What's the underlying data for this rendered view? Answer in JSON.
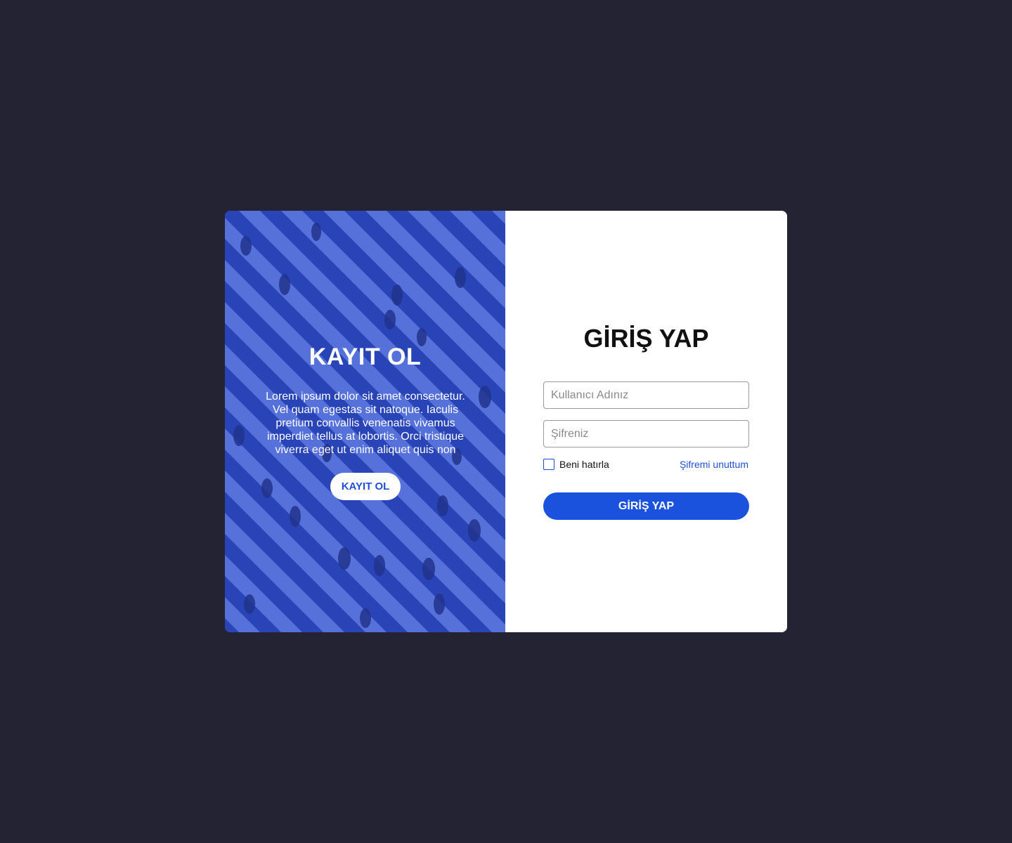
{
  "signup_panel": {
    "title": "KAYIT OL",
    "description": "Lorem ipsum dolor sit amet consectetur. Vel quam egestas sit natoque. Iaculis pretium convallis venenatis vivamus imperdiet tellus at lobortis. Orci tristique viverra eget ut enim aliquet quis non",
    "button_label": "KAYIT OL",
    "background_image": "crosswalk-crowd-photo",
    "overlay_color": "#2f4fc4"
  },
  "login_panel": {
    "title": "GİRİŞ YAP",
    "username_placeholder": "Kullanıcı Adınız",
    "password_placeholder": "Şifreniz",
    "remember_label": "Beni hatırla",
    "forgot_label": "Şifremi unuttum",
    "button_label": "GİRİŞ YAP",
    "accent_color": "#1a52de"
  },
  "page": {
    "background_color": "#232333"
  }
}
